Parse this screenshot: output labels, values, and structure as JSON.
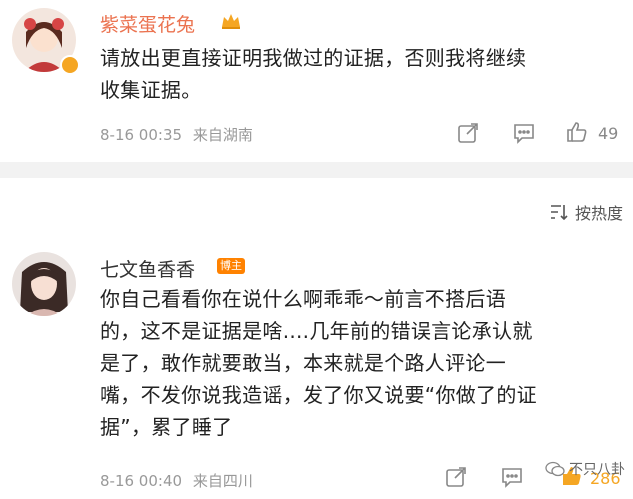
{
  "comments": [
    {
      "username": "紫菜蛋花兔",
      "text_lines": [
        "请放出更直接证明我做过的证据，否则我将继续",
        "收集证据。"
      ],
      "time": "8-16 00:35",
      "source": "来自湖南",
      "likes": "49",
      "name_color": "#eb7350"
    },
    {
      "username": "七文鱼香香",
      "badge": "博主",
      "text_lines": [
        "你自己看看你在说什么啊乖乖～前言不搭后语",
        "的，这不是证据是啥....几年前的错误言论承认就",
        "是了，敢作就要敢当，本来就是个路人评论一",
        "嘴，不发你说我造谣，发了你又说要“你做了的证",
        "据”，累了睡了"
      ],
      "time": "8-16 00:40",
      "source": "来自四川",
      "likes": "286",
      "name_color": "#333333"
    }
  ],
  "sort": {
    "label": "按热度",
    "icon": "sort-icon"
  },
  "watermark": {
    "text": "不只八卦",
    "icon": "wechat-icon"
  },
  "colors": {
    "accent": "#eb7350",
    "badge": "#ff8200",
    "like_active": "#f5a623"
  }
}
